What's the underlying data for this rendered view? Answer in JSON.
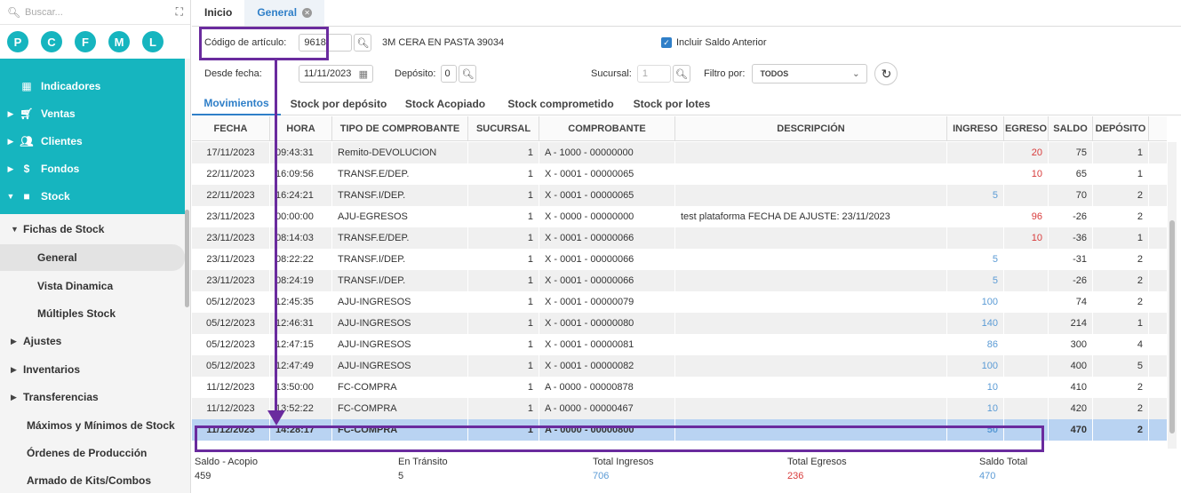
{
  "sidebar": {
    "search_placeholder": "Buscar...",
    "shortcuts": [
      "P",
      "C",
      "F",
      "M",
      "L"
    ],
    "nav": [
      {
        "label": "Indicadores"
      },
      {
        "label": "Ventas"
      },
      {
        "label": "Clientes"
      },
      {
        "label": "Fondos"
      },
      {
        "label": "Stock"
      }
    ],
    "stock_group": "Fichas de Stock",
    "sub": [
      "General",
      "Vista Dinamica",
      "Múltiples Stock"
    ],
    "groups": [
      "Ajustes",
      "Inventarios",
      "Transferencias"
    ],
    "more": [
      "Máximos y Mínimos de Stock",
      "Órdenes de Producción",
      "Armado de Kits/Combos"
    ]
  },
  "tabs": [
    {
      "label": "Inicio"
    },
    {
      "label": "General"
    }
  ],
  "filters": {
    "codigo_label": "Código de artículo:",
    "codigo_value": "9618",
    "articulo_desc": "3M CERA EN PASTA 39034",
    "incluir_saldo": "Incluir Saldo Anterior",
    "desde_label": "Desde fecha:",
    "desde_value": "11/11/2023",
    "deposito_label": "Depósito:",
    "deposito_value": "0",
    "sucursal_label": "Sucursal:",
    "sucursal_value": "1",
    "filtro_label": "Filtro por:",
    "filtro_value": "TODOS"
  },
  "subtabs": [
    "Movimientos",
    "Stock por depósito",
    "Stock Acopiado",
    "Stock comprometido",
    "Stock por lotes"
  ],
  "columns": [
    "FECHA",
    "HORA",
    "TIPO DE COMPROBANTE",
    "SUCURSAL",
    "COMPROBANTE",
    "DESCRIPCIÓN",
    "INGRESO",
    "EGRESO",
    "SALDO",
    "DEPÓSITO"
  ],
  "rows": [
    {
      "fecha": "17/11/2023",
      "hora": "09:43:31",
      "tipo": "Remito-DEVOLUCION",
      "suc": "1",
      "comp": "A - 1000 - 00000000",
      "desc": "",
      "ing": "",
      "egr": "20",
      "saldo": "75",
      "dep": "1"
    },
    {
      "fecha": "22/11/2023",
      "hora": "16:09:56",
      "tipo": "TRANSF.E/DEP.",
      "suc": "1",
      "comp": "X - 0001 - 00000065",
      "desc": "",
      "ing": "",
      "egr": "10",
      "saldo": "65",
      "dep": "1"
    },
    {
      "fecha": "22/11/2023",
      "hora": "16:24:21",
      "tipo": "TRANSF.I/DEP.",
      "suc": "1",
      "comp": "X - 0001 - 00000065",
      "desc": "",
      "ing": "5",
      "egr": "",
      "saldo": "70",
      "dep": "2"
    },
    {
      "fecha": "23/11/2023",
      "hora": "00:00:00",
      "tipo": "AJU-EGRESOS",
      "suc": "1",
      "comp": "X - 0000 - 00000000",
      "desc": "test plataforma FECHA DE AJUSTE: 23/11/2023",
      "ing": "",
      "egr": "96",
      "saldo": "-26",
      "dep": "2"
    },
    {
      "fecha": "23/11/2023",
      "hora": "08:14:03",
      "tipo": "TRANSF.E/DEP.",
      "suc": "1",
      "comp": "X - 0001 - 00000066",
      "desc": "",
      "ing": "",
      "egr": "10",
      "saldo": "-36",
      "dep": "1"
    },
    {
      "fecha": "23/11/2023",
      "hora": "08:22:22",
      "tipo": "TRANSF.I/DEP.",
      "suc": "1",
      "comp": "X - 0001 - 00000066",
      "desc": "",
      "ing": "5",
      "egr": "",
      "saldo": "-31",
      "dep": "2"
    },
    {
      "fecha": "23/11/2023",
      "hora": "08:24:19",
      "tipo": "TRANSF.I/DEP.",
      "suc": "1",
      "comp": "X - 0001 - 00000066",
      "desc": "",
      "ing": "5",
      "egr": "",
      "saldo": "-26",
      "dep": "2"
    },
    {
      "fecha": "05/12/2023",
      "hora": "12:45:35",
      "tipo": "AJU-INGRESOS",
      "suc": "1",
      "comp": "X - 0001 - 00000079",
      "desc": "",
      "ing": "100",
      "egr": "",
      "saldo": "74",
      "dep": "2"
    },
    {
      "fecha": "05/12/2023",
      "hora": "12:46:31",
      "tipo": "AJU-INGRESOS",
      "suc": "1",
      "comp": "X - 0001 - 00000080",
      "desc": "",
      "ing": "140",
      "egr": "",
      "saldo": "214",
      "dep": "1"
    },
    {
      "fecha": "05/12/2023",
      "hora": "12:47:15",
      "tipo": "AJU-INGRESOS",
      "suc": "1",
      "comp": "X - 0001 - 00000081",
      "desc": "",
      "ing": "86",
      "egr": "",
      "saldo": "300",
      "dep": "4"
    },
    {
      "fecha": "05/12/2023",
      "hora": "12:47:49",
      "tipo": "AJU-INGRESOS",
      "suc": "1",
      "comp": "X - 0001 - 00000082",
      "desc": "",
      "ing": "100",
      "egr": "",
      "saldo": "400",
      "dep": "5"
    },
    {
      "fecha": "11/12/2023",
      "hora": "13:50:00",
      "tipo": "FC-COMPRA",
      "suc": "1",
      "comp": "A - 0000 - 00000878",
      "desc": "",
      "ing": "10",
      "egr": "",
      "saldo": "410",
      "dep": "2"
    },
    {
      "fecha": "11/12/2023",
      "hora": "13:52:22",
      "tipo": "FC-COMPRA",
      "suc": "1",
      "comp": "A - 0000 - 00000467",
      "desc": "",
      "ing": "10",
      "egr": "",
      "saldo": "420",
      "dep": "2"
    },
    {
      "fecha": "11/12/2023",
      "hora": "14:28:17",
      "tipo": "FC-COMPRA",
      "suc": "1",
      "comp": "A - 0000 - 00000800",
      "desc": "",
      "ing": "50",
      "egr": "",
      "saldo": "470",
      "dep": "2"
    }
  ],
  "footer": {
    "saldo_acopio_label": "Saldo - Acopio",
    "saldo_acopio": "459",
    "transito_label": "En Tránsito",
    "transito": "5",
    "ingresos_label": "Total Ingresos",
    "ingresos": "706",
    "egresos_label": "Total Egresos",
    "egresos": "236",
    "saldo_total_label": "Saldo Total",
    "saldo_total": "470"
  },
  "colors": {
    "teal": "#16b5bf",
    "accent_blue": "#2f7fc8",
    "annotation": "#6a2b9e",
    "egreso_red": "#d83b3b"
  }
}
